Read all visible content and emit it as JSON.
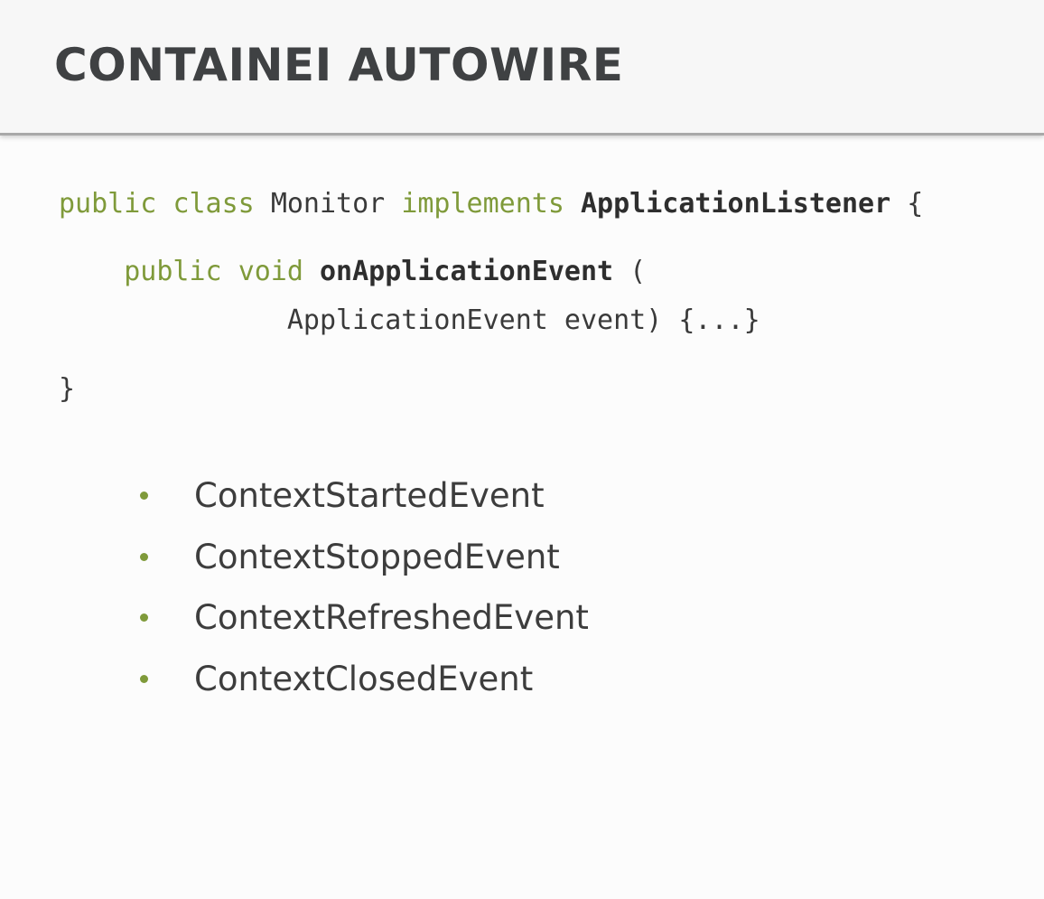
{
  "title": "CONTAINEI AUTOWIRE",
  "code": {
    "line1": {
      "kw1": "public",
      "kw2": "class",
      "name": "Monitor",
      "kw3": "implements",
      "iface": "ApplicationListener",
      "brace": "{"
    },
    "line2": {
      "kw1": "public",
      "kw2": "void",
      "method": "onApplicationEvent",
      "paren": "("
    },
    "line3": {
      "param": "ApplicationEvent event) {...}"
    },
    "line4": {
      "brace": "}"
    }
  },
  "events": [
    "ContextStartedEvent",
    "ContextStoppedEvent",
    "ContextRefreshedEvent",
    "ContextClosedEvent"
  ],
  "colors": {
    "keyword": "#7f9a3a",
    "title": "#3f4143",
    "text": "#3d3d3d"
  }
}
